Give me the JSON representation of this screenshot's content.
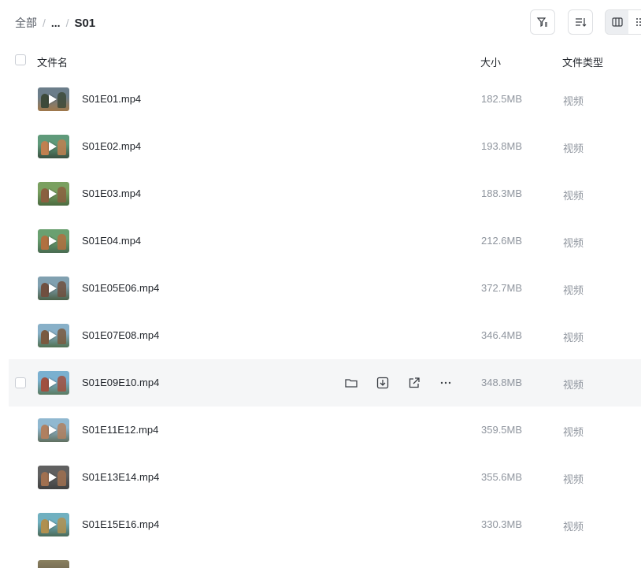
{
  "breadcrumb": {
    "root": "全部",
    "ellipsis": "...",
    "current": "S01"
  },
  "toolbar": {
    "filter_icon": "filter-icon",
    "sort_icon": "sort-icon",
    "view_icons": [
      "column-view-icon",
      "grid-view-icon"
    ]
  },
  "table": {
    "headers": {
      "name": "文件名",
      "size": "大小",
      "type": "文件类型"
    },
    "rows": [
      {
        "name": "S01E01.mp4",
        "size": "182.5MB",
        "type": "视频",
        "thumb": [
          "#6b7d8a",
          "#3d4a3a",
          "#a0784a"
        ]
      },
      {
        "name": "S01E02.mp4",
        "size": "193.8MB",
        "type": "视频",
        "thumb": [
          "#5f9a7a",
          "#c08050",
          "#3a5040"
        ]
      },
      {
        "name": "S01E03.mp4",
        "size": "188.3MB",
        "type": "视频",
        "thumb": [
          "#7aa060",
          "#8a6040",
          "#4a6a40"
        ]
      },
      {
        "name": "S01E04.mp4",
        "size": "212.6MB",
        "type": "视频",
        "thumb": [
          "#6aa070",
          "#b07040",
          "#486a50"
        ]
      },
      {
        "name": "S01E05E06.mp4",
        "size": "372.7MB",
        "type": "视频",
        "thumb": [
          "#80a0b0",
          "#705040",
          "#4a6048"
        ]
      },
      {
        "name": "S01E07E08.mp4",
        "size": "346.4MB",
        "type": "视频",
        "thumb": [
          "#88b0c8",
          "#7a5a40",
          "#507050"
        ]
      },
      {
        "name": "S01E09E10.mp4",
        "size": "348.8MB",
        "type": "视频",
        "thumb": [
          "#7ab0d0",
          "#a05040",
          "#5a7a60"
        ]
      },
      {
        "name": "S01E11E12.mp4",
        "size": "359.5MB",
        "type": "视频",
        "thumb": [
          "#90b8d0",
          "#b08060",
          "#607060"
        ]
      },
      {
        "name": "S01E13E14.mp4",
        "size": "355.6MB",
        "type": "视频",
        "thumb": [
          "#606060",
          "#a07050",
          "#404040"
        ]
      },
      {
        "name": "S01E15E16.mp4",
        "size": "330.3MB",
        "type": "视频",
        "thumb": [
          "#70b0c0",
          "#b09050",
          "#4a6a58"
        ]
      }
    ],
    "hover_row_index": 6,
    "hover_actions": [
      "folder-icon",
      "download-icon",
      "share-icon",
      "more-icon"
    ]
  }
}
